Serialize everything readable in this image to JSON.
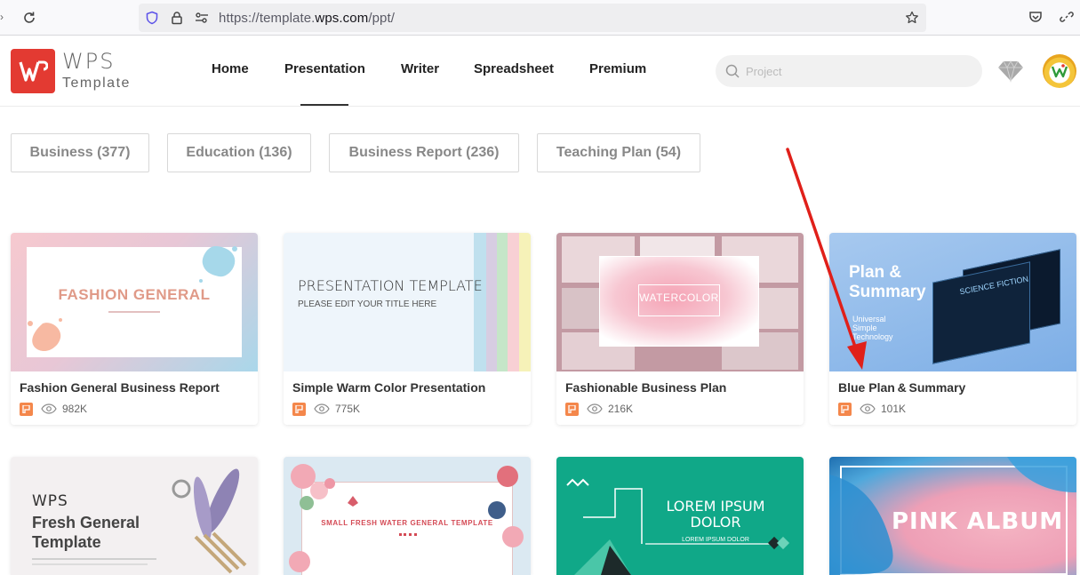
{
  "browser": {
    "url_prefix": "https://template.",
    "url_domain": "wps.com",
    "url_suffix": "/ppt/"
  },
  "header": {
    "logo_wps": "WPS",
    "logo_template": "Template",
    "nav": [
      {
        "label": "Home"
      },
      {
        "label": "Presentation"
      },
      {
        "label": "Writer"
      },
      {
        "label": "Spreadsheet"
      },
      {
        "label": "Premium"
      }
    ],
    "active_nav": "Presentation",
    "search_placeholder": "Project"
  },
  "categories": [
    {
      "label": "Business (377)"
    },
    {
      "label": "Education (136)"
    },
    {
      "label": "Business Report (236)"
    },
    {
      "label": "Teaching Plan (54)"
    }
  ],
  "cards": [
    {
      "title": "Fashion General Business Report",
      "views": "982K",
      "thumb_text": "FASHION GENERAL"
    },
    {
      "title": "Simple Warm Color Presentation",
      "views": "775K",
      "thumb_text": "PRESENTATION TEMPLATE",
      "thumb_sub": "PLEASE EDIT YOUR TITLE HERE"
    },
    {
      "title": "Fashionable Business Plan",
      "views": "216K",
      "thumb_text": "WATERCOLOR"
    },
    {
      "title": "Blue Plan & Summary",
      "views": "101K",
      "thumb_text1": "Plan &",
      "thumb_text2": "Summary",
      "thumb_sub1": "Universal",
      "thumb_sub2": "Simple",
      "thumb_sub3": "Technology",
      "thumb_screen": "SCIENCE FICTION"
    },
    {
      "thumb_logo": "WPS",
      "thumb_text1": "Fresh General",
      "thumb_text2": "Template"
    },
    {
      "thumb_text": "SMALL FRESH WATER GENERAL TEMPLATE"
    },
    {
      "thumb_text1": "LOREM IPSUM",
      "thumb_text2": "DOLOR",
      "thumb_sub": "LOREM IPSUM DOLOR"
    },
    {
      "thumb_text": "PINK ALBUM"
    }
  ],
  "colors": {
    "brand_red": "#e33a32",
    "ppt_orange": "#f4874b",
    "annotation_arrow": "#e0201a"
  }
}
